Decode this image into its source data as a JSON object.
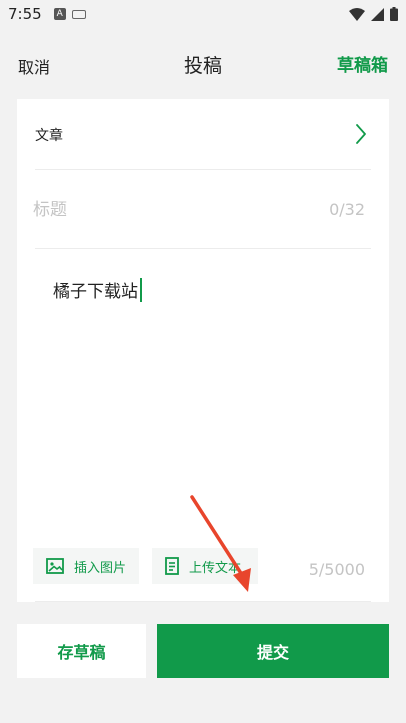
{
  "status_bar": {
    "time": "7:55",
    "notification_icon_letter": "A",
    "icons": [
      "a-notification-icon",
      "keyboard-icon",
      "wifi-icon",
      "signal-icon",
      "battery-icon"
    ]
  },
  "header": {
    "cancel_label": "取消",
    "title": "投稿",
    "drafts_label": "草稿箱"
  },
  "form": {
    "category_label": "文章",
    "title_placeholder": "标题",
    "title_value": "",
    "title_count": "0/32",
    "body_text": "橘子下载站",
    "insert_image_label": "插入图片",
    "upload_text_label": "上传文本",
    "body_count": "5/5000"
  },
  "footer": {
    "save_draft_label": "存草稿",
    "submit_label": "提交"
  },
  "colors": {
    "accent": "#119a4a",
    "background": "#f2f2f2",
    "card": "#ffffff",
    "placeholder": "#c4c4c4",
    "annotation_arrow": "#e8452c"
  }
}
